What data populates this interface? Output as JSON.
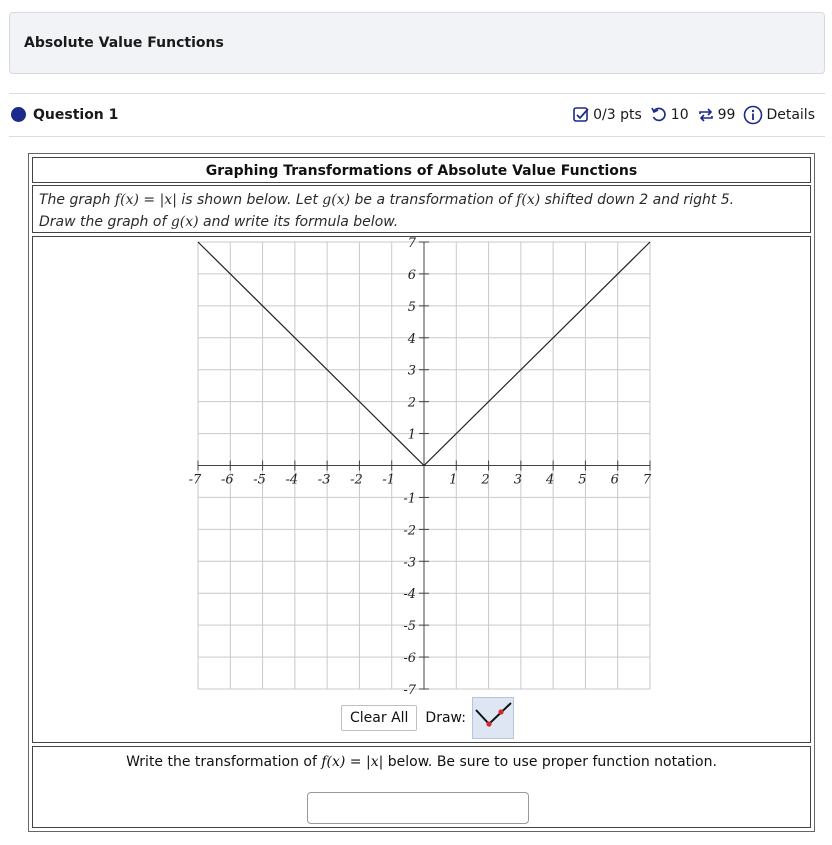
{
  "assignment": {
    "title": "Absolute Value Functions"
  },
  "question": {
    "label": "Question 1",
    "score": "0/3 pts",
    "retries": "10",
    "attempts": "99",
    "details": "Details",
    "status_color": "#1c2a8c"
  },
  "problem": {
    "title": "Graphing Transformations of Absolute Value Functions",
    "line1_a": "The graph ",
    "f_of_x": "f(x)",
    "equals": " = ",
    "abs_x": "|x|",
    "line1_b": " is shown below. Let ",
    "g_of_x": "g(x)",
    "line1_c": " be a transformation of ",
    "line1_d": " shifted down 2 and right 5.",
    "line2_a": "Draw the graph of ",
    "line2_b": " and write its formula below."
  },
  "graph": {
    "x_ticks": [
      "-7",
      "-6",
      "-5",
      "-4",
      "-3",
      "-2",
      "-1",
      "1",
      "2",
      "3",
      "4",
      "5",
      "6",
      "7"
    ],
    "y_ticks": [
      "7",
      "6",
      "5",
      "4",
      "3",
      "2",
      "1",
      "-1",
      "-2",
      "-3",
      "-4",
      "-5",
      "-6",
      "-7"
    ],
    "function": "f(x) = |x|",
    "x_range": [
      -7,
      7
    ],
    "y_range": [
      -7,
      7
    ]
  },
  "toolbar": {
    "clear_label": "Clear All",
    "draw_label": "Draw:",
    "tool": "absolute-value-tool-icon"
  },
  "answer": {
    "prompt_a": "Write the transformation of ",
    "prompt_b": " below. Be sure to use proper function notation.",
    "input_value": ""
  }
}
